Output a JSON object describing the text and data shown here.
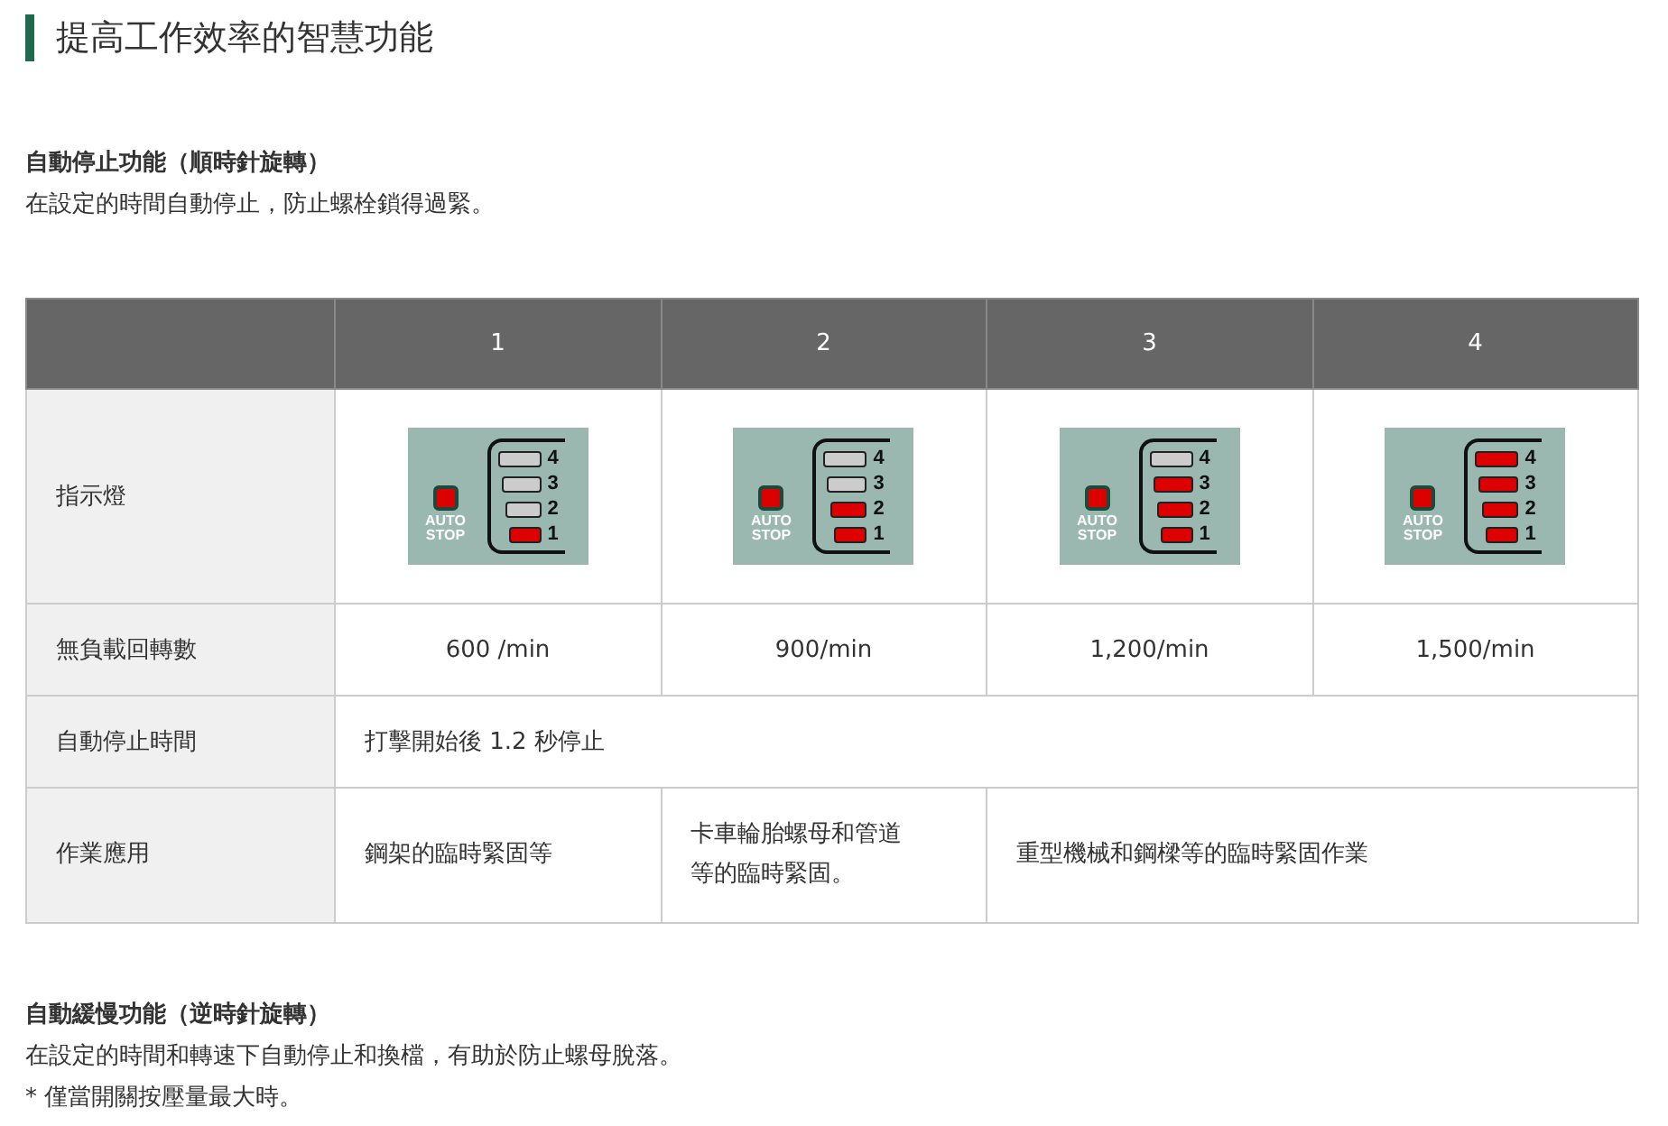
{
  "heading": "提高工作效率的智慧功能",
  "section1": {
    "title": "自動停止功能（順時針旋轉）",
    "text": "在設定的時間自動停止，防止螺栓鎖得過緊。"
  },
  "table": {
    "columns": [
      "1",
      "2",
      "3",
      "4"
    ],
    "indicator_row": {
      "label": "指示燈",
      "panels": [
        {
          "auto_label": [
            "AUTO",
            "STOP"
          ],
          "leds": [
            {
              "number": "4",
              "on": false
            },
            {
              "number": "3",
              "on": false
            },
            {
              "number": "2",
              "on": false
            },
            {
              "number": "1",
              "on": true
            }
          ]
        },
        {
          "auto_label": [
            "AUTO",
            "STOP"
          ],
          "leds": [
            {
              "number": "4",
              "on": false
            },
            {
              "number": "3",
              "on": false
            },
            {
              "number": "2",
              "on": true
            },
            {
              "number": "1",
              "on": true
            }
          ]
        },
        {
          "auto_label": [
            "AUTO",
            "STOP"
          ],
          "leds": [
            {
              "number": "4",
              "on": false
            },
            {
              "number": "3",
              "on": true
            },
            {
              "number": "2",
              "on": true
            },
            {
              "number": "1",
              "on": true
            }
          ]
        },
        {
          "auto_label": [
            "AUTO",
            "STOP"
          ],
          "leds": [
            {
              "number": "4",
              "on": true
            },
            {
              "number": "3",
              "on": true
            },
            {
              "number": "2",
              "on": true
            },
            {
              "number": "1",
              "on": true
            }
          ]
        }
      ]
    },
    "speed_row": {
      "label": "無負載回轉數",
      "cells": [
        "600 /min",
        "900/min",
        "1,200/min",
        "1,500/min"
      ]
    },
    "time_row": {
      "label": "自動停止時間",
      "cell": "打擊開始後 1.2 秒停止"
    },
    "use_row": {
      "label": "作業應用",
      "cells": [
        "鋼架的臨時緊固等",
        "卡車輪胎螺母和管道等的臨時緊固。",
        "重型機械和鋼樑等的臨時緊固作業"
      ]
    }
  },
  "section2": {
    "title": "自動緩慢功能（逆時針旋轉）",
    "text": "在設定的時間和轉速下自動停止和換檔，有助於防止螺母脫落。",
    "note": "* 僅當開關按壓量最大時。"
  }
}
